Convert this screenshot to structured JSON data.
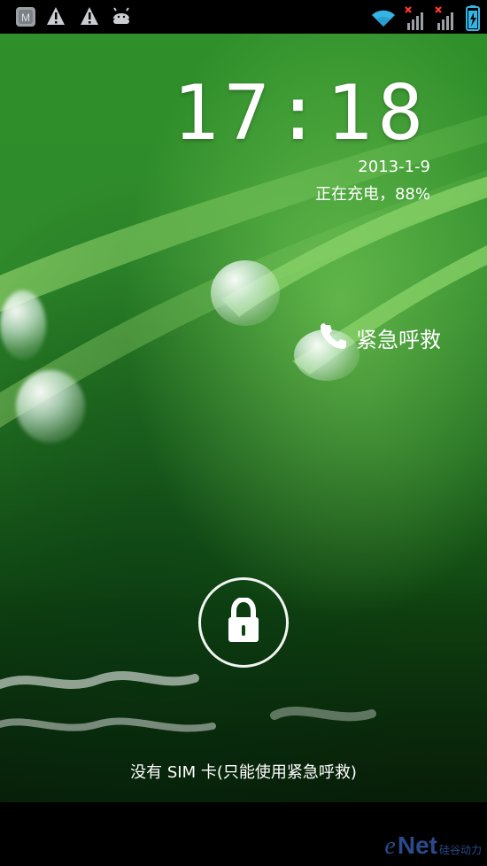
{
  "status_bar": {
    "icons_left": [
      "app-icon",
      "warning-icon",
      "warning-icon",
      "android-icon"
    ],
    "icons_right": [
      "wifi-icon",
      "signal-no-sim-icon",
      "signal-no-sim-icon",
      "battery-charging-icon"
    ],
    "icon_colors": {
      "active": "#33b5e5",
      "gray": "#9aa0a6",
      "error": "#ff3b30"
    }
  },
  "lockscreen": {
    "time": "17:18",
    "date": "2013-1-9",
    "charging_status": "正在充电，88%",
    "emergency_call_label": "紧急呼救",
    "no_sim_message": "没有 SIM 卡(只能使用紧急呼救)"
  },
  "watermark": {
    "brand_e": "e",
    "brand_net": "Net",
    "brand_cn": "硅谷动力"
  },
  "colors": {
    "wallpaper_primary": "#2f8f2a",
    "wallpaper_dark": "#0b2d0c",
    "text": "#ffffff"
  }
}
